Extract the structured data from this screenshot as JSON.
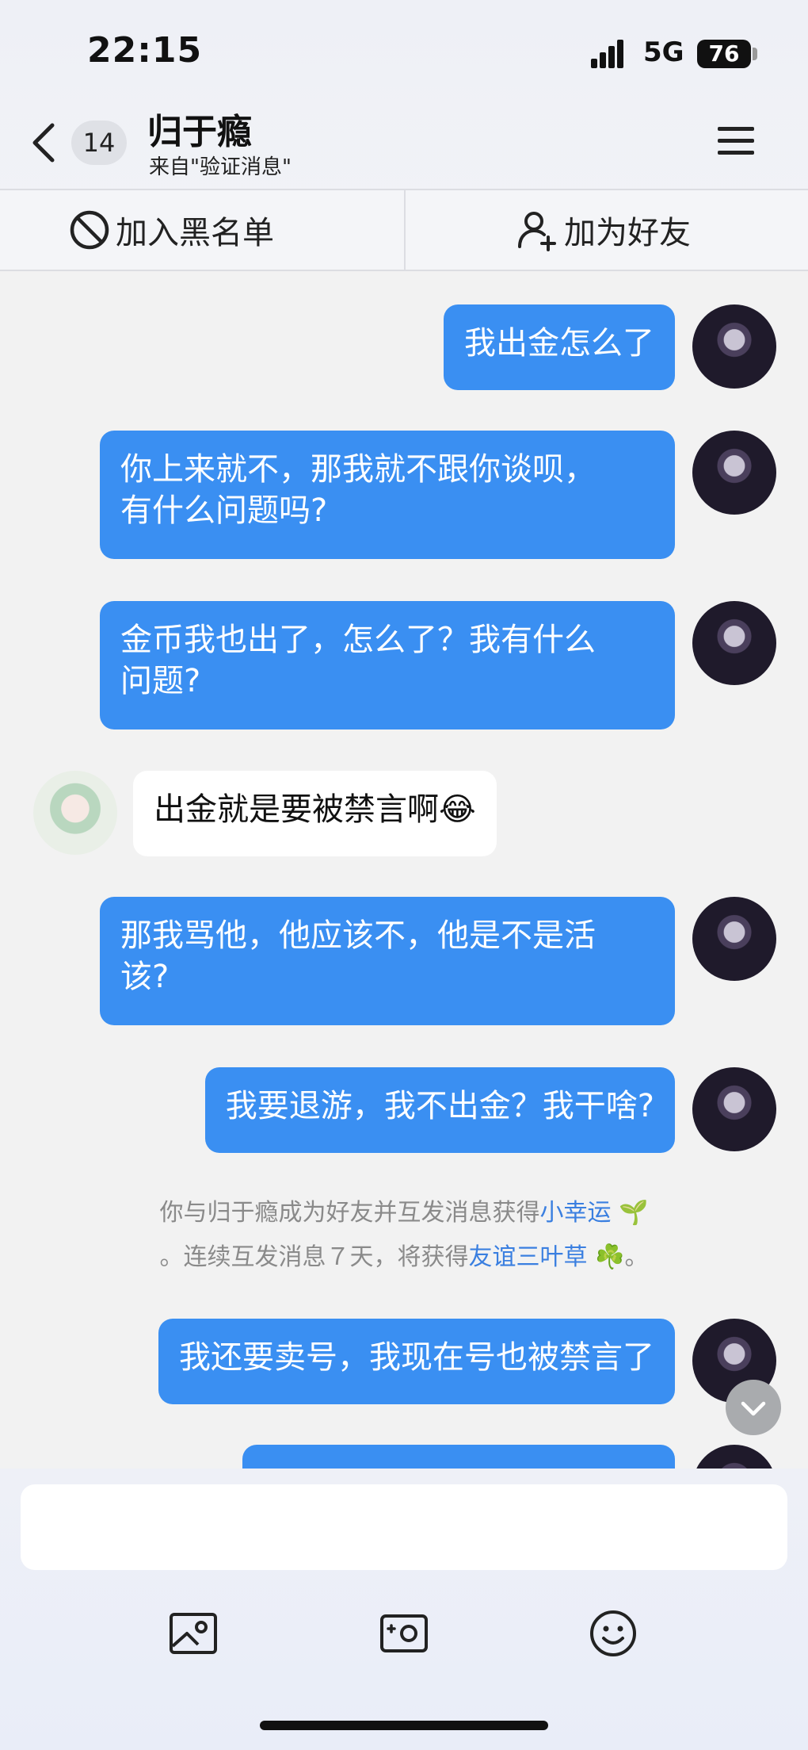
{
  "status_bar": {
    "time": "22:15",
    "network": "5G",
    "battery": "76"
  },
  "header": {
    "back_icon": "chevron-left-icon",
    "unread_badge": "14",
    "contact_name": "归于瘾",
    "source_label": "来自\"验证消息\"",
    "menu_icon": "hamburger-menu-icon"
  },
  "actions": {
    "block_label": "加入黑名单",
    "block_icon": "block-icon",
    "add_friend_label": "加为好友",
    "add_friend_icon": "add-user-icon"
  },
  "messages": [
    {
      "from": "me",
      "text": "我出金怎么了"
    },
    {
      "from": "me",
      "text": "你上来就不，那我就不跟你谈呗，\n有什么问题吗?"
    },
    {
      "from": "me",
      "text": "金币我也出了，怎么了？我有什么\n问题?"
    },
    {
      "from": "other",
      "text": "出金就是要被禁言啊😂"
    },
    {
      "from": "me",
      "text": "那我骂他，他应该不，他是不是活\n该?"
    },
    {
      "from": "me",
      "text": "我要退游，我不出金？我干啥?"
    },
    {
      "from": "me",
      "text": "我还要卖号，我现在号也被禁言了"
    },
    {
      "from": "me",
      "text": ""
    }
  ],
  "system_note": {
    "line1_prefix": "你与归于瘾成为好友并互发消息获得",
    "line1_link": "小幸运",
    "line1_emoji": "🌱",
    "line2_prefix": "。连续互发消息７天，将获得",
    "line2_link": "友谊三叶草",
    "line2_emoji": "☘️",
    "line2_suffix": "。"
  },
  "colors": {
    "my_bubble": "#3a8ff2",
    "other_bubble": "#ffffff",
    "link": "#3a7fe0"
  },
  "toolbar": {
    "icons": [
      "gallery-icon",
      "camera-icon",
      "emoji-icon"
    ]
  }
}
